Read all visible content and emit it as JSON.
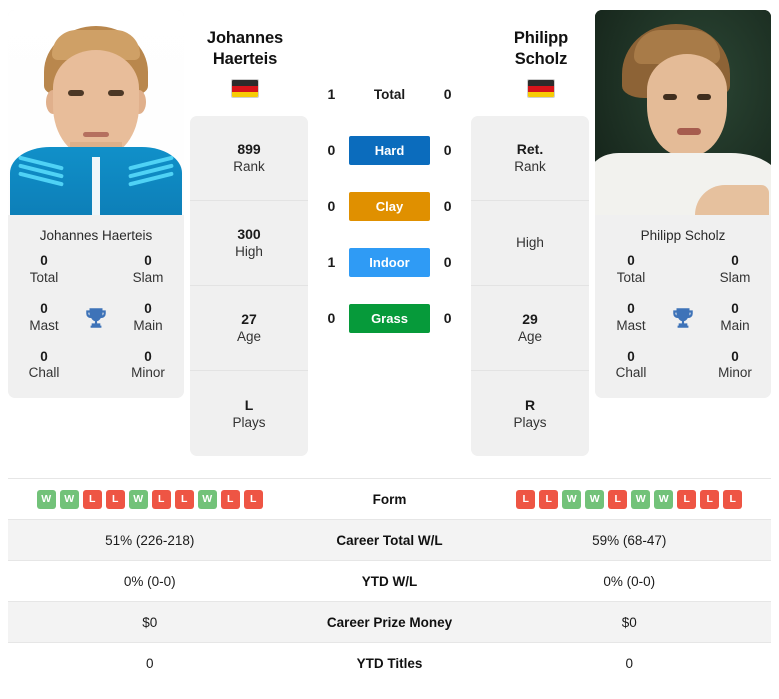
{
  "players": {
    "left": {
      "name": "Johannes Haerteis",
      "display_name_lines": [
        "Johannes",
        "Haerteis"
      ],
      "country": "Germany",
      "flag": "de-flag-icon",
      "photo_caption": "Johannes Haerteis",
      "stats_card": [
        {
          "value": "899",
          "label": "Rank"
        },
        {
          "value": "300",
          "label": "High"
        },
        {
          "value": "27",
          "label": "Age"
        },
        {
          "value": "L",
          "label": "Plays"
        }
      ],
      "titles": [
        {
          "value": "0",
          "label": "Total"
        },
        {
          "value": "0",
          "label": "Slam"
        },
        {
          "value": "0",
          "label": "Mast"
        },
        {
          "value": "0",
          "label": "Main"
        },
        {
          "value": "0",
          "label": "Chall"
        },
        {
          "value": "0",
          "label": "Minor"
        }
      ],
      "form": [
        "W",
        "W",
        "L",
        "L",
        "W",
        "L",
        "L",
        "W",
        "L",
        "L"
      ],
      "career_total_wl": "51% (226-218)",
      "ytd_wl": "0% (0-0)",
      "career_prize_money": "$0",
      "ytd_titles": "0"
    },
    "right": {
      "name": "Philipp Scholz",
      "display_name_lines": [
        "Philipp",
        "Scholz"
      ],
      "country": "Germany",
      "flag": "de-flag-icon",
      "photo_caption": "Philipp Scholz",
      "stats_card": [
        {
          "value": "Ret.",
          "label": "Rank"
        },
        {
          "value": "",
          "label": "High"
        },
        {
          "value": "29",
          "label": "Age"
        },
        {
          "value": "R",
          "label": "Plays"
        }
      ],
      "titles": [
        {
          "value": "0",
          "label": "Total"
        },
        {
          "value": "0",
          "label": "Slam"
        },
        {
          "value": "0",
          "label": "Mast"
        },
        {
          "value": "0",
          "label": "Main"
        },
        {
          "value": "0",
          "label": "Chall"
        },
        {
          "value": "0",
          "label": "Minor"
        }
      ],
      "form": [
        "L",
        "L",
        "W",
        "W",
        "L",
        "W",
        "W",
        "L",
        "L",
        "L"
      ],
      "career_total_wl": "59% (68-47)",
      "ytd_wl": "0% (0-0)",
      "career_prize_money": "$0",
      "ytd_titles": "0"
    }
  },
  "head_to_head": [
    {
      "label": "Total",
      "left": "1",
      "right": "0",
      "color": "",
      "style": "plain"
    },
    {
      "label": "Hard",
      "left": "0",
      "right": "0",
      "color": "#0b6cbd",
      "style": "badge"
    },
    {
      "label": "Clay",
      "left": "0",
      "right": "0",
      "color": "#e09000",
      "style": "badge"
    },
    {
      "label": "Indoor",
      "left": "1",
      "right": "0",
      "color": "#2f9bf5",
      "style": "badge"
    },
    {
      "label": "Grass",
      "left": "0",
      "right": "0",
      "color": "#069a3a",
      "style": "badge"
    }
  ],
  "stat_rows": [
    {
      "label": "Form",
      "key": "form",
      "type": "form"
    },
    {
      "label": "Career Total W/L",
      "key": "career_total_wl",
      "type": "text"
    },
    {
      "label": "YTD W/L",
      "key": "ytd_wl",
      "type": "text"
    },
    {
      "label": "Career Prize Money",
      "key": "career_prize_money",
      "type": "text"
    },
    {
      "label": "YTD Titles",
      "key": "ytd_titles",
      "type": "text"
    }
  ],
  "colors": {
    "win_badge": "#72c279",
    "loss_badge": "#ee5544",
    "trophy": "#3e73b8",
    "card_bg": "#f0f0f0",
    "row_alt_bg": "#f3f3f3"
  },
  "icons": {
    "trophy": "trophy-icon",
    "flag": "de-flag-icon"
  }
}
